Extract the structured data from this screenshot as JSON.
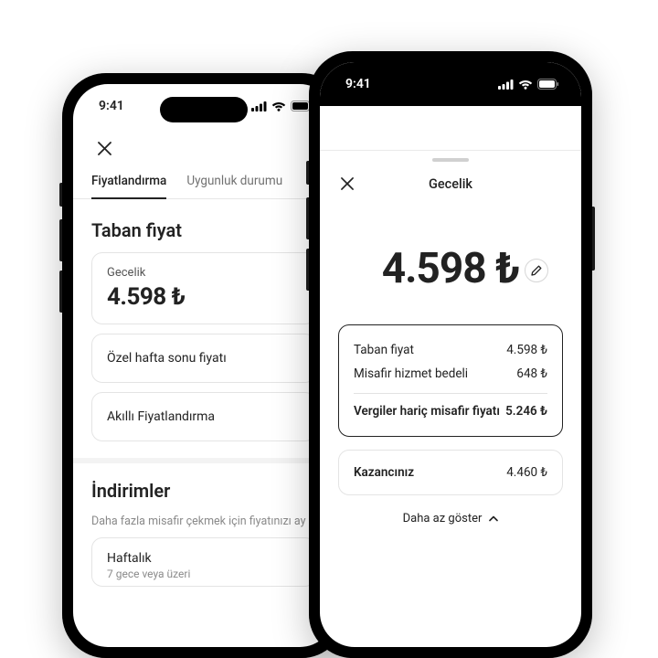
{
  "status": {
    "time": "9:41"
  },
  "left": {
    "tabs": {
      "pricing": "Fiyatlandırma",
      "availability": "Uygunluk durumu"
    },
    "base_price_title": "Taban fiyat",
    "nightly_label": "Gecelik",
    "nightly_price": "4.598 ₺",
    "weekend_price_label": "Özel hafta sonu fiyatı",
    "smart_pricing_label": "Akıllı Fiyatlandırma",
    "discounts_title": "İndirimler",
    "discounts_sub": "Daha fazla misafir çekmek için fiyatınızı ay",
    "weekly_label": "Haftalık",
    "weekly_sub": "7 gece veya üzeri"
  },
  "right": {
    "sheet_title": "Gecelik",
    "hero_price": "4.598 ₺",
    "rows": {
      "base_label": "Taban fiyat",
      "base_value": "4.598 ₺",
      "service_label": "Misafir hizmet bedeli",
      "service_value": "648 ₺",
      "total_label": "Vergiler hariç misafir fiyatı",
      "total_value": "5.246 ₺"
    },
    "earnings_label": "Kazancınız",
    "earnings_value": "4.460 ₺",
    "show_less": "Daha az göster"
  }
}
